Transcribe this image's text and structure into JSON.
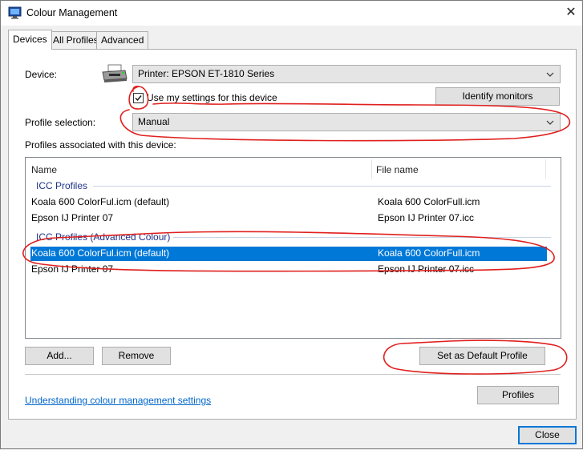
{
  "window": {
    "title": "Colour Management",
    "close_glyph": "✕"
  },
  "tabs": [
    {
      "label": "Devices",
      "active": true
    },
    {
      "label": "All Profiles",
      "active": false
    },
    {
      "label": "Advanced",
      "active": false
    }
  ],
  "device": {
    "label": "Device:",
    "selected": "Printer: EPSON ET-1810 Series",
    "icon": "printer-icon",
    "use_settings_label": "Use my settings for this device",
    "use_settings_checked": true,
    "identify_button": "Identify monitors"
  },
  "profile_selection": {
    "label": "Profile selection:",
    "selected": "Manual"
  },
  "associated_label": "Profiles associated with this device:",
  "profiles_list": {
    "columns": [
      "Name",
      "File name"
    ],
    "groups": [
      {
        "title": "ICC Profiles",
        "rows": [
          {
            "name": "Koala 600 ColorFul.icm (default)",
            "file": "Koala 600 ColorFull.icm",
            "selected": false
          },
          {
            "name": "Epson IJ Printer 07",
            "file": "Epson IJ Printer 07.icc",
            "selected": false
          }
        ]
      },
      {
        "title": "ICC Profiles (Advanced Colour)",
        "rows": [
          {
            "name": "Koala 600 ColorFul.icm (default)",
            "file": "Koala 600 ColorFull.icm",
            "selected": true
          },
          {
            "name": "Epson IJ Printer 07",
            "file": "Epson IJ Printer 07.icc",
            "selected": false
          }
        ]
      }
    ]
  },
  "buttons": {
    "add": "Add...",
    "remove": "Remove",
    "set_default": "Set as Default Profile",
    "profiles": "Profiles",
    "close": "Close"
  },
  "help_link": "Understanding colour management settings",
  "colors": {
    "selection": "#0078d7",
    "annotation": "#e0201e",
    "link": "#0066cc",
    "group_header": "#1e3287"
  }
}
